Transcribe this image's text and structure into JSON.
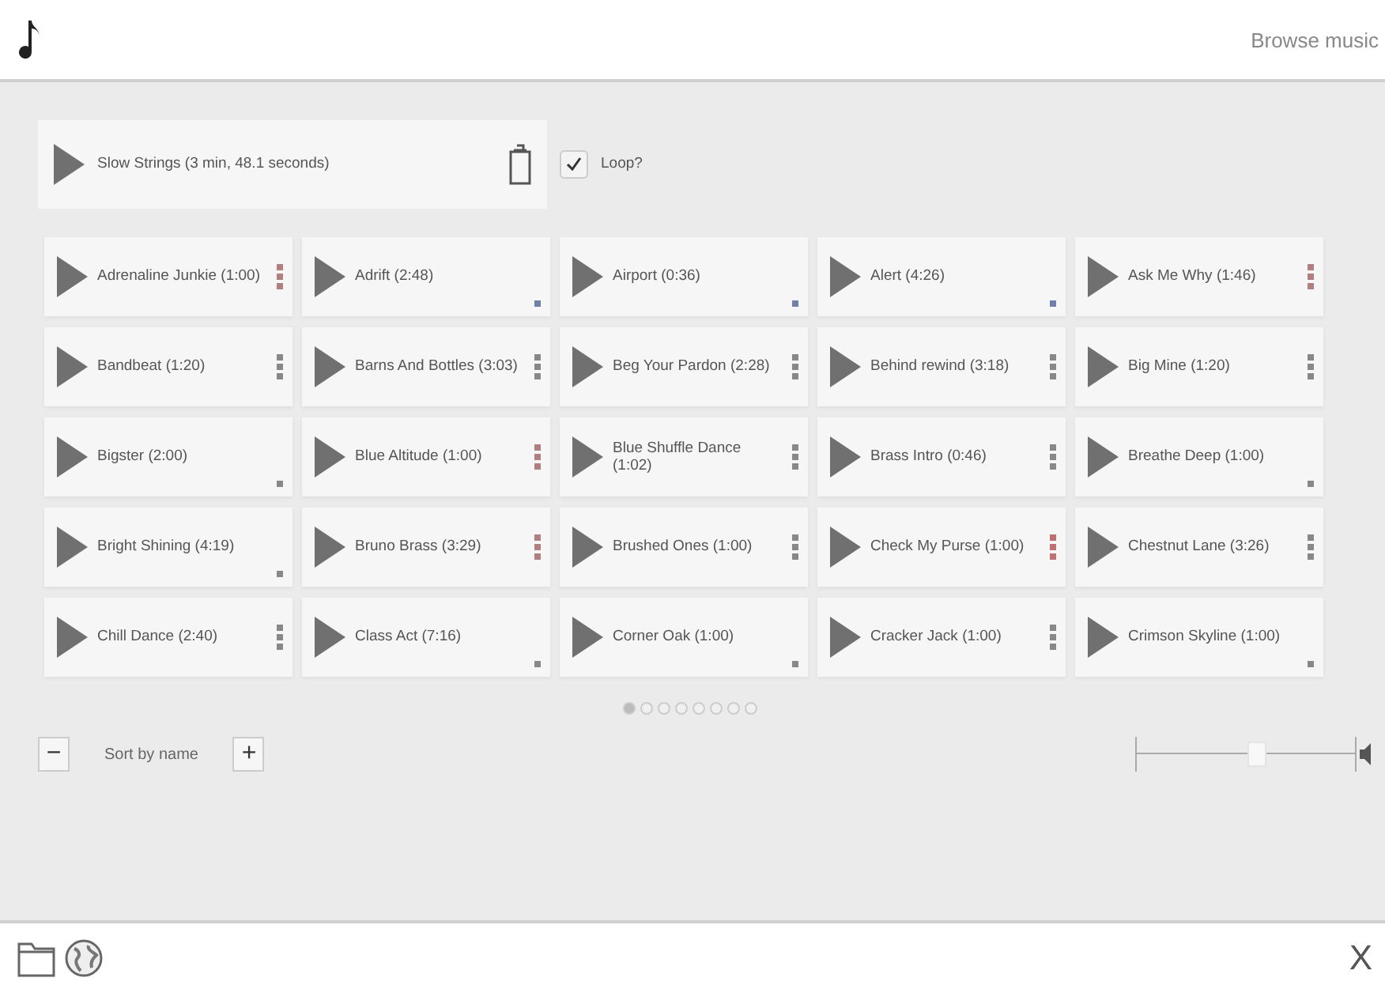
{
  "header": {
    "link": "Browse music"
  },
  "now_playing": {
    "title": "Slow Strings (3 min, 48.1 seconds)",
    "loop": {
      "label": "Loop?",
      "checked": true
    }
  },
  "tracks": [
    {
      "title": "Adrenaline Junkie (1:00)",
      "kind": "stack",
      "color": "#b08080"
    },
    {
      "title": "Adrift (2:48)",
      "kind": "single",
      "color": "#7080a8"
    },
    {
      "title": "Airport (0:36)",
      "kind": "single",
      "color": "#7080a8"
    },
    {
      "title": "Alert (4:26)",
      "kind": "single",
      "color": "#7080a8"
    },
    {
      "title": "Ask Me Why (1:46)",
      "kind": "stack",
      "color": "#b08080"
    },
    {
      "title": "Bandbeat (1:20)",
      "kind": "stack",
      "color": "#888888"
    },
    {
      "title": "Barns And Bottles (3:03)",
      "kind": "stack",
      "color": "#888888"
    },
    {
      "title": "Beg Your Pardon (2:28)",
      "kind": "stack",
      "color": "#888888"
    },
    {
      "title": "Behind rewind (3:18)",
      "kind": "stack",
      "color": "#888888"
    },
    {
      "title": "Big Mine (1:20)",
      "kind": "stack",
      "color": "#888888"
    },
    {
      "title": "Bigster (2:00)",
      "kind": "single",
      "color": "#888888"
    },
    {
      "title": "Blue Altitude (1:00)",
      "kind": "stack",
      "color": "#b08080"
    },
    {
      "title": "Blue Shuffle Dance (1:02)",
      "kind": "stack",
      "color": "#888888"
    },
    {
      "title": "Brass Intro (0:46)",
      "kind": "stack",
      "color": "#888888"
    },
    {
      "title": "Breathe Deep (1:00)",
      "kind": "single",
      "color": "#888888"
    },
    {
      "title": "Bright Shining (4:19)",
      "kind": "single",
      "color": "#888888"
    },
    {
      "title": "Bruno Brass (3:29)",
      "kind": "stack",
      "color": "#b08080"
    },
    {
      "title": "Brushed Ones (1:00)",
      "kind": "stack",
      "color": "#888888"
    },
    {
      "title": "Check My Purse (1:00)",
      "kind": "stack",
      "color": "#c07070"
    },
    {
      "title": "Chestnut Lane (3:26)",
      "kind": "stack",
      "color": "#888888"
    },
    {
      "title": "Chill Dance (2:40)",
      "kind": "stack",
      "color": "#888888"
    },
    {
      "title": "Class Act (7:16)",
      "kind": "single",
      "color": "#888888"
    },
    {
      "title": "Corner Oak (1:00)",
      "kind": "single",
      "color": "#888888"
    },
    {
      "title": "Cracker Jack (1:00)",
      "kind": "stack",
      "color": "#888888"
    },
    {
      "title": "Crimson Skyline (1:00)",
      "kind": "single",
      "color": "#888888"
    }
  ],
  "pages": [
    {
      "selected": true
    },
    {
      "selected": false
    },
    {
      "selected": false
    },
    {
      "selected": false
    },
    {
      "selected": false
    },
    {
      "selected": false
    },
    {
      "selected": false
    },
    {
      "selected": false
    }
  ],
  "sort": {
    "minus": "−",
    "label": "Sort by name",
    "plus": "+"
  },
  "volume": {
    "level": 0.55
  },
  "footer": {
    "close": "X"
  }
}
